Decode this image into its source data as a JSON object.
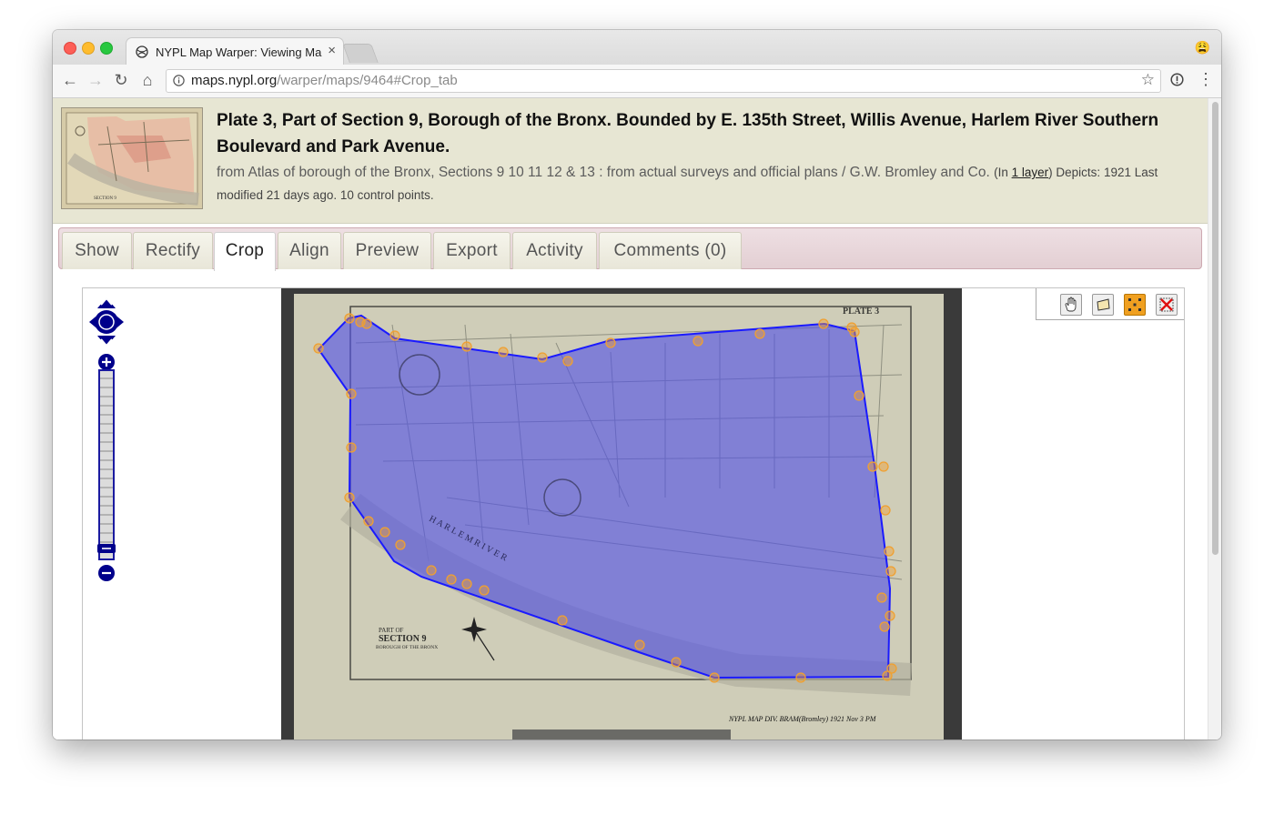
{
  "browser": {
    "tab_title": "NYPL Map Warper: Viewing Ma",
    "tab_close": "×",
    "url_host": "maps.nypl.org",
    "url_path": "/warper/maps/9464#Crop_tab",
    "profile_emoji": "😩"
  },
  "header": {
    "title": "Plate 3, Part of Section 9, Borough of the Bronx. Bounded by E. 135th Street, Willis Avenue, Harlem River Southern Boulevard and Park Avenue.",
    "from_text": "from Atlas of borough of the Bronx, Sections 9 10 11 12 & 13 : from actual surveys and official plans / G.W. Bromley and Co.",
    "in_prefix": "(In ",
    "layer_link": "1 layer",
    "in_suffix": ")",
    "depicts": "Depicts: 1921",
    "last_modified": "Last modified 21 days ago.",
    "control_points": "10 control points."
  },
  "tabs": [
    {
      "label": "Show"
    },
    {
      "label": "Rectify"
    },
    {
      "label": "Crop",
      "active": true
    },
    {
      "label": "Align"
    },
    {
      "label": "Preview"
    },
    {
      "label": "Export"
    },
    {
      "label": "Activity"
    },
    {
      "label": "Comments (0)"
    }
  ],
  "map": {
    "plate_label": "PLATE 3",
    "section_label_line1": "PART OF",
    "section_label_line2": "SECTION 9",
    "section_label_line3": "BOROUGH OF THE BRONX",
    "river_label": "H A R L E M   R I V E R",
    "handwritten_note": "NYPL MAP DIV. BRAM(Bromley) 1921 Nov 3 PM",
    "crop_fill": "#5050e6",
    "crop_stroke": "#1a1aff",
    "vertex_color": "#f0a030",
    "icons": [
      "pan-icon",
      "zoom-box-icon",
      "modify-polygon-icon",
      "delete-icon"
    ]
  }
}
